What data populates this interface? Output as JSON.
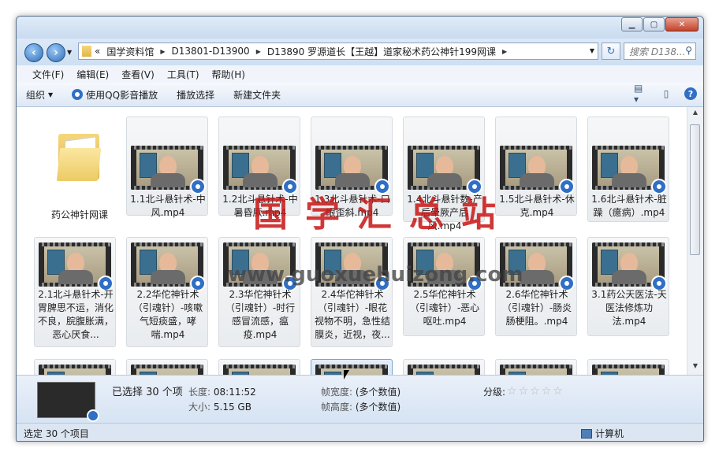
{
  "address": {
    "overflow": "«",
    "crumbs": [
      "国学资料馆",
      "D13801-D13900",
      "D13890 罗源道长【王越】道家秘术药公神针199网课"
    ]
  },
  "search": {
    "placeholder": "搜索 D138..."
  },
  "menu": {
    "file": "文件(F)",
    "edit": "编辑(E)",
    "view": "查看(V)",
    "tools": "工具(T)",
    "help": "帮助(H)"
  },
  "toolbar": {
    "organize": "组织",
    "play_qq": "使用QQ影音播放",
    "play_select": "播放选择",
    "new_folder": "新建文件夹"
  },
  "folder": {
    "name": "药公神针网课"
  },
  "files": [
    "1.1北斗悬针术-中风.mp4",
    "1.2北斗悬针术-中暑昏厥.mp4",
    "1.3北斗悬针术-口眼歪斜.mp4",
    "1.4北斗悬针数-产后晕厥产后风.mp4",
    "1.5北斗悬针术-休克.mp4",
    "1.6北斗悬针术-脏躁（癔病）.mp4",
    "2.1北斗悬针术-开胃脾思不运，消化不良，脘腹胀满，恶心厌食...",
    "2.2华佗神针术（引魂针）-咳嗽气短痰盛，哮喘.mp4",
    "2.3华佗神针术（引魂针）-时行感冒流感，瘟疫.mp4",
    "2.4华佗神针术（引魂针）-眼花视物不明，急性结膜炎，近视，夜...",
    "2.5华佗神针术（引魂针）-恶心呕吐.mp4",
    "2.6华佗神针术（引魂针）-肠炎肠梗阻。.mp4",
    "3.1药公天医法-天医法修炼功法.mp4"
  ],
  "watermark": {
    "line1": "国学汇总站",
    "line2": "www.guoxuehuizong.com"
  },
  "details": {
    "selected": "已选择 30 个项",
    "length_label": "长度:",
    "length": "08:11:52",
    "size_label": "大小:",
    "size": "5.15 GB",
    "frame_width_label": "帧宽度:",
    "frame_width": "(多个数值)",
    "frame_height_label": "帧高度:",
    "frame_height": "(多个数值)",
    "rating_label": "分级:",
    "rating": 0
  },
  "status": {
    "left": "选定 30 个项目",
    "right": "计算机"
  }
}
